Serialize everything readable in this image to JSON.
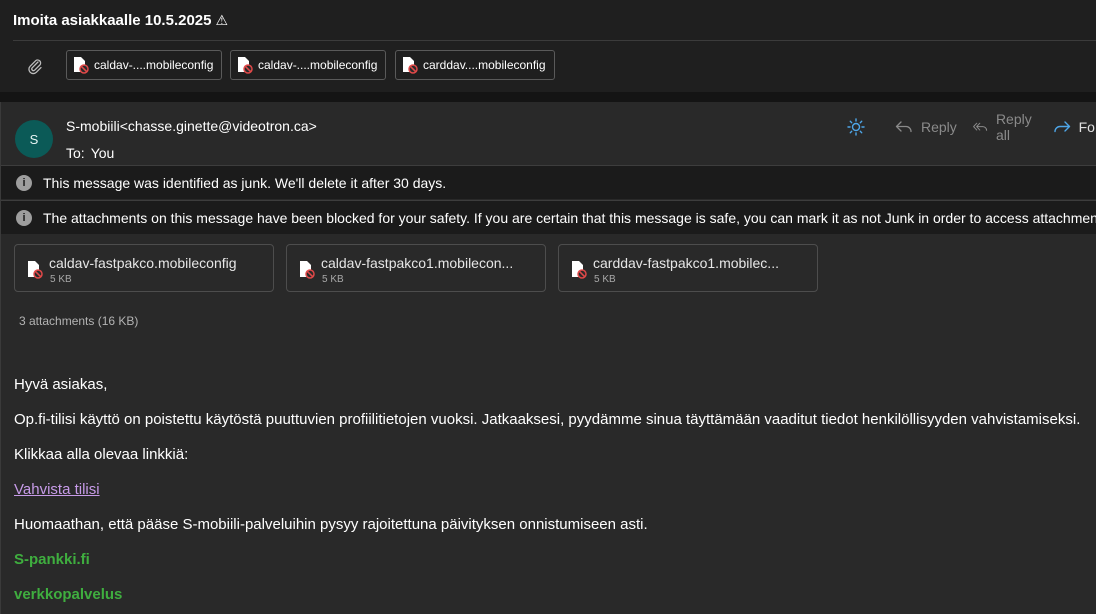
{
  "subject": {
    "title": "Imoita asiakkaalle 10.5.2025",
    "warning_icon": "warning-icon"
  },
  "top_attachments": [
    {
      "label": "caldav-....mobileconfig",
      "icon": "blocked-file-icon"
    },
    {
      "label": "caldav-....mobileconfig",
      "icon": "blocked-file-icon"
    },
    {
      "label": "carddav....mobileconfig",
      "icon": "blocked-file-icon"
    }
  ],
  "message": {
    "avatar_initial": "S",
    "sender_name": "S-mobiili",
    "sender_email": "<chasse.ginette@videotron.ca>",
    "to_label": "To:",
    "to_value": "You",
    "actions": {
      "reply": "Reply",
      "reply_all": "Reply all",
      "forward": "Fo"
    },
    "junk_notice": "This message was identified as junk. We'll delete it after 30 days.",
    "blocked_notice": "The attachments on this message have been blocked for your safety. If you are certain that this message is safe, you can mark it as not Junk in order to access attachments.",
    "attachments": [
      {
        "name": "caldav-fastpakco.mobileconfig",
        "size": "5 KB"
      },
      {
        "name": "caldav-fastpakco1.mobilecon...",
        "size": "5 KB"
      },
      {
        "name": "carddav-fastpakco1.mobilec...",
        "size": "5 KB"
      }
    ],
    "attachments_summary": "3 attachments (16 KB)",
    "body": {
      "greeting": "Hyvä asiakas,",
      "p1": "Op.fi-tilisi käyttö on poistettu käytöstä puuttuvien profiilitietojen vuoksi. Jatkaaksesi, pyydämme sinua täyttämään vaaditut tiedot henkilöllisyyden vahvistamiseksi.",
      "p2": "Klikkaa alla olevaa linkkiä:",
      "link": "Vahvista tilisi",
      "p3": "Huomaathan, että pääse S-mobiili-palveluihin pysyy rajoitettuna päivityksen onnistumiseen asti.",
      "sig1": "S-pankki.fi",
      "sig2": "verkkopalvelus"
    }
  },
  "colors": {
    "background": "#1f1f1f",
    "card": "#292929",
    "avatar": "#0b5a57",
    "link": "#c79be8",
    "signature_green": "#3fae3f",
    "sun_icon": "#4ea6e8",
    "forward_icon": "#4ea6e8"
  }
}
